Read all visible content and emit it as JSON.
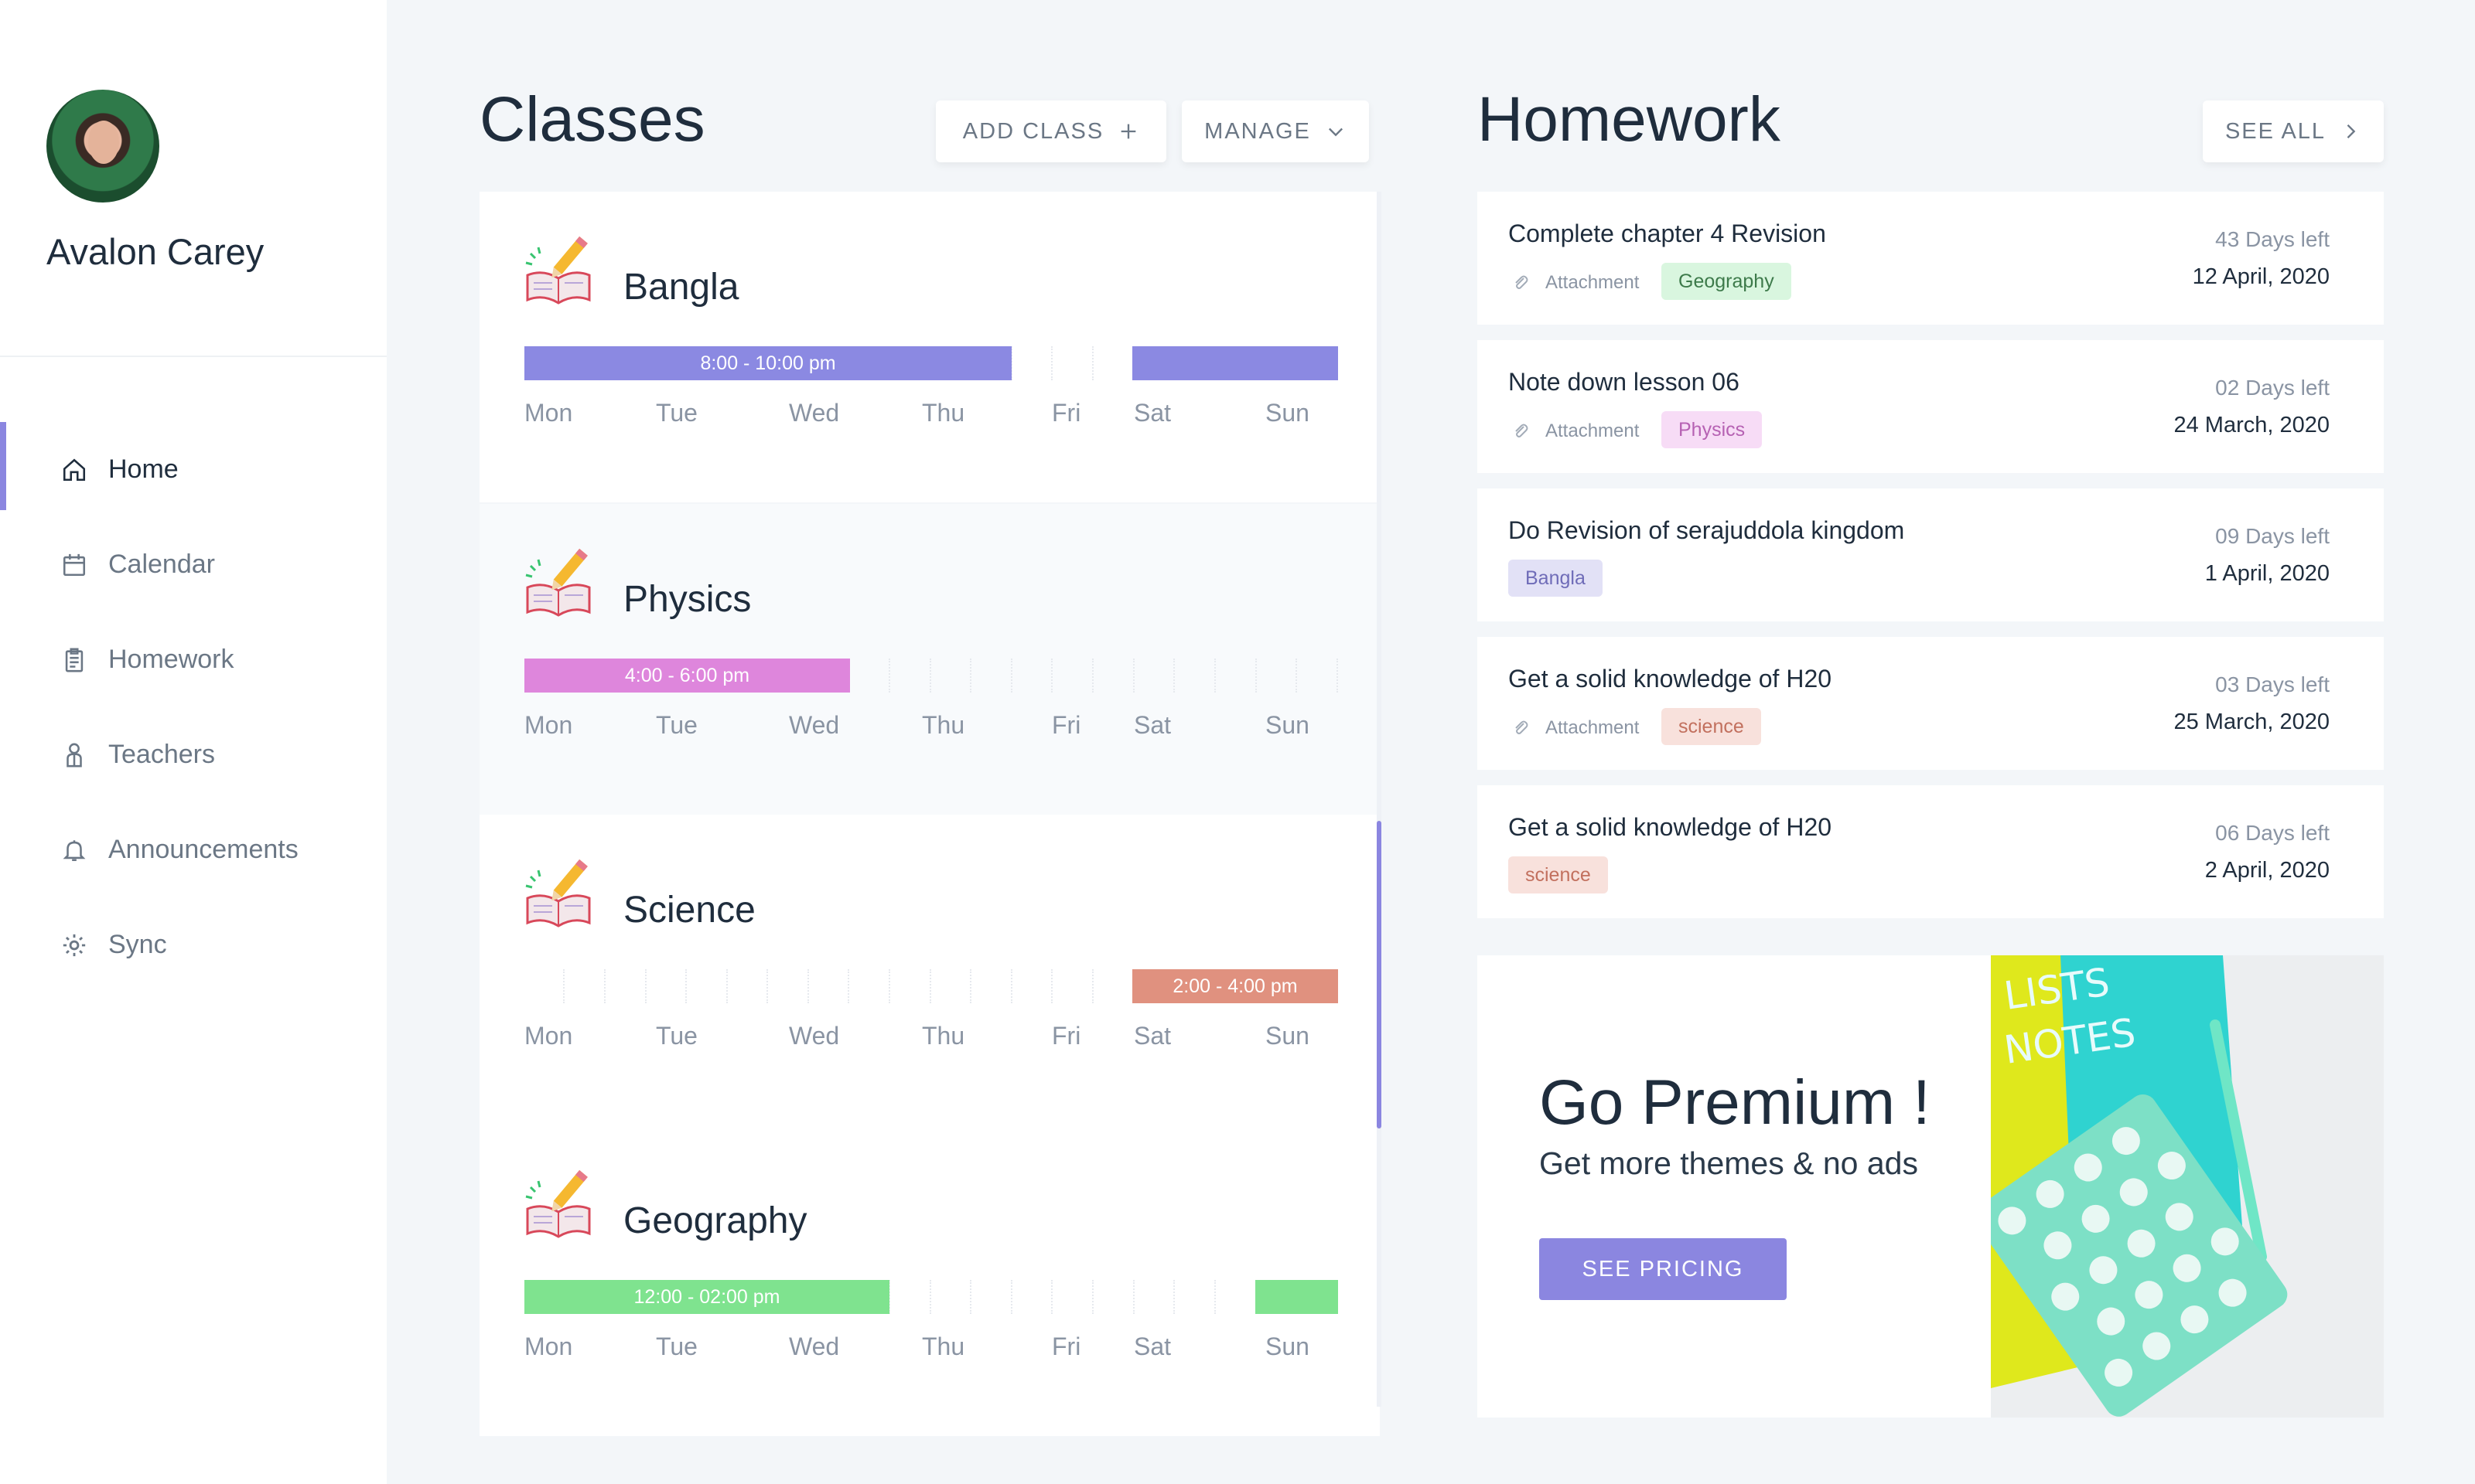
{
  "profile": {
    "name": "Avalon Carey"
  },
  "nav": [
    {
      "label": "Home",
      "icon": "home-icon",
      "active": true
    },
    {
      "label": "Calendar",
      "icon": "calendar-icon"
    },
    {
      "label": "Homework",
      "icon": "clipboard-icon"
    },
    {
      "label": "Teachers",
      "icon": "teacher-icon"
    },
    {
      "label": "Announcements",
      "icon": "bell-icon"
    },
    {
      "label": "Sync",
      "icon": "gear-icon"
    }
  ],
  "classes": {
    "title": "Classes",
    "add_label": "ADD CLASS",
    "manage_label": "MANAGE",
    "days": [
      "Mon",
      "Tue",
      "Wed",
      "Thu",
      "Fri",
      "Sat",
      "Sun"
    ],
    "items": [
      {
        "name": "Bangla",
        "color": "#8b89e2",
        "time": "8:00 - 10:00 pm"
      },
      {
        "name": "Physics",
        "color": "#de86dc",
        "time": "4:00 - 6:00 pm"
      },
      {
        "name": "Science",
        "color": "#e0917f",
        "time": "2:00 - 4:00 pm"
      },
      {
        "name": "Geography",
        "color": "#7fe38f",
        "time": "12:00 - 02:00 pm"
      }
    ]
  },
  "homework": {
    "title": "Homework",
    "see_all_label": "SEE ALL",
    "attachment_label": "Attachment",
    "items": [
      {
        "title": "Complete chapter 4 Revision",
        "attachment": true,
        "tag": "Geography",
        "tag_bg": "#d9f6df",
        "tag_fg": "#3d7a4a",
        "days_left": "43 Days left",
        "date": "12 April, 2020"
      },
      {
        "title": "Note down lesson 06",
        "attachment": true,
        "tag": "Physics",
        "tag_bg": "#f7dcf6",
        "tag_fg": "#b661b3",
        "days_left": "02 Days left",
        "date": "24 March, 2020"
      },
      {
        "title": "Do Revision of serajuddola kingdom",
        "attachment": false,
        "tag": "Bangla",
        "tag_bg": "#e2e1f6",
        "tag_fg": "#6f6cb8",
        "days_left": "09 Days left",
        "date": "1 April, 2020"
      },
      {
        "title": "Get a solid knowledge of H20",
        "attachment": true,
        "tag": "science",
        "tag_bg": "#f8e1dc",
        "tag_fg": "#c2705e",
        "days_left": "03 Days left",
        "date": "25 March, 2020"
      },
      {
        "title": "Get a solid knowledge of H20",
        "attachment": false,
        "tag": "science",
        "tag_bg": "#f8e1dc",
        "tag_fg": "#c2705e",
        "days_left": "06 Days left",
        "date": "2 April, 2020"
      }
    ]
  },
  "premium": {
    "title": "Go Premium !",
    "subtitle": "Get more themes & no ads",
    "button_label": "SEE PRICING",
    "art_text_1": "LISTS",
    "art_text_2": "NOTES"
  }
}
